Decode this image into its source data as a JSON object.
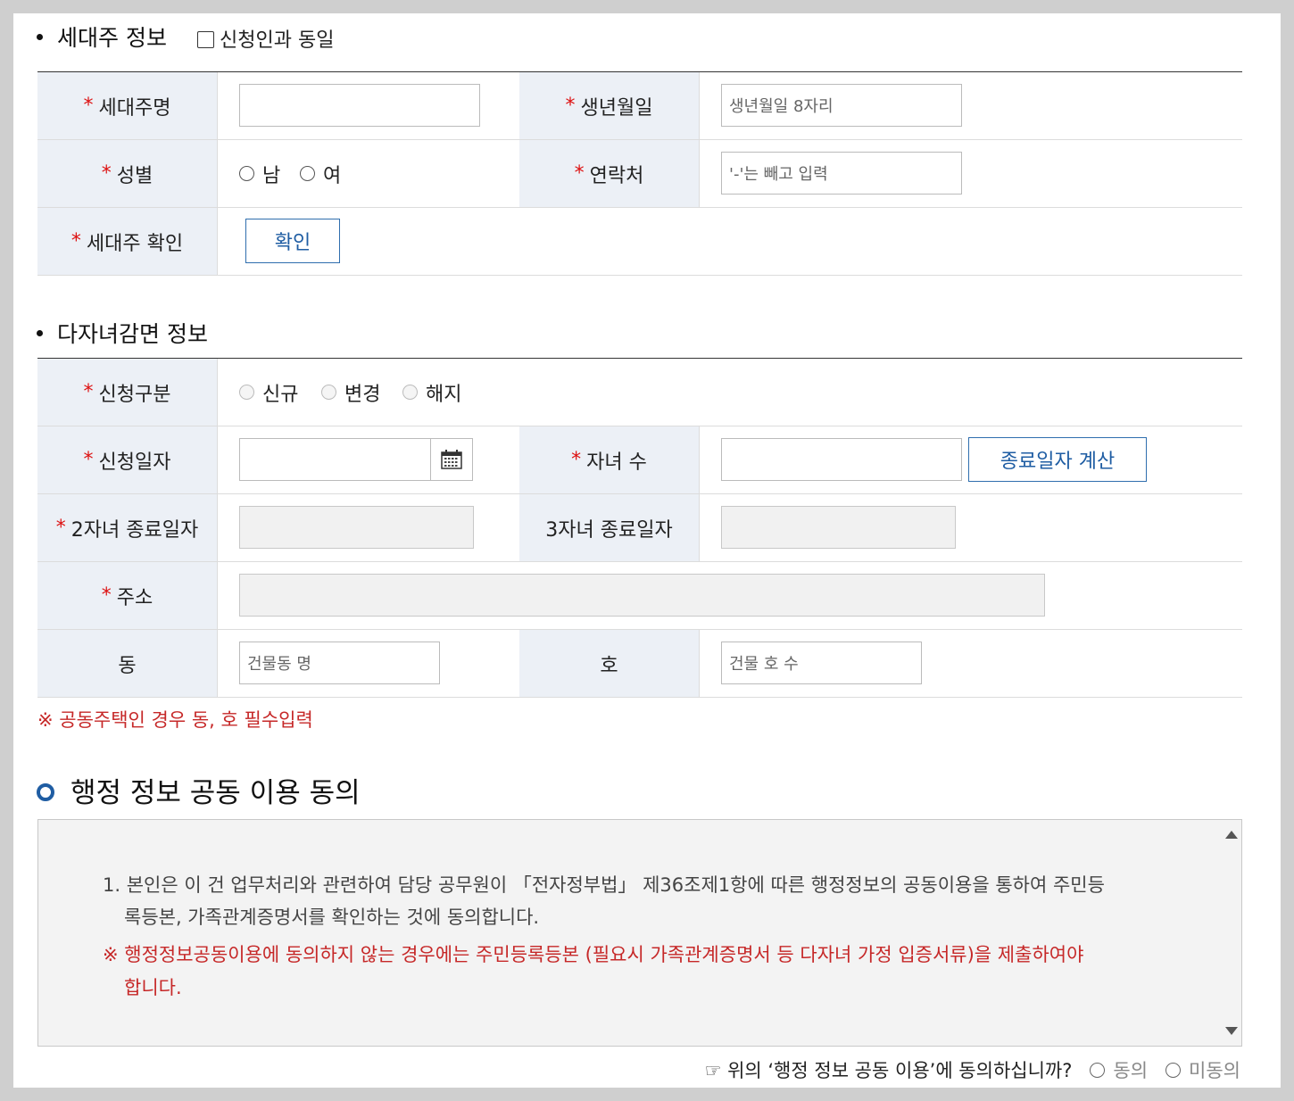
{
  "householder": {
    "title": "세대주 정보",
    "same_as_applicant": "신청인과 동일",
    "name_label": "세대주명",
    "birth_label": "생년월일",
    "birth_placeholder": "생년월일 8자리",
    "gender_label": "성별",
    "gender_male": "남",
    "gender_female": "여",
    "contact_label": "연락처",
    "contact_placeholder": "'-'는 빼고 입력",
    "verify_label": "세대주 확인",
    "verify_button": "확인"
  },
  "multichild": {
    "title": "다자녀감면 정보",
    "type_label": "신청구분",
    "type_new": "신규",
    "type_change": "변경",
    "type_cancel": "해지",
    "date_label": "신청일자",
    "children_label": "자녀 수",
    "calc_button": "종료일자 계산",
    "end2_label": "2자녀 종료일자",
    "end3_label": "3자녀 종료일자",
    "address_label": "주소",
    "dong_label": "동",
    "dong_placeholder": "건물동 명",
    "ho_label": "호",
    "ho_placeholder": "건물 호 수",
    "note": "※ 공동주택인 경우 동, 호 필수입력"
  },
  "agreement": {
    "title": "행정 정보 공동 이용 동의",
    "p1_line1": "1. 본인은 이 건 업무처리와 관련하여 담당 공무원이 「전자정부법」 제36조제1항에 따른 행정정보의 공동이용을 통하여 주민등",
    "p1_line2": "록등본, 가족관계증명서를 확인하는 것에 동의합니다.",
    "p2_line1": "※ 행정정보공동이용에 동의하지 않는 경우에는 주민등록등본 (필요시 가족관계증명서 등 다자녀 가정 입증서류)을 제출하여야",
    "p2_line2": "합니다.",
    "question": "☞ 위의 ‘행정 정보 공동 이용’에 동의하십니까?",
    "agree": "동의",
    "disagree": "미동의"
  },
  "required_mark": "*"
}
